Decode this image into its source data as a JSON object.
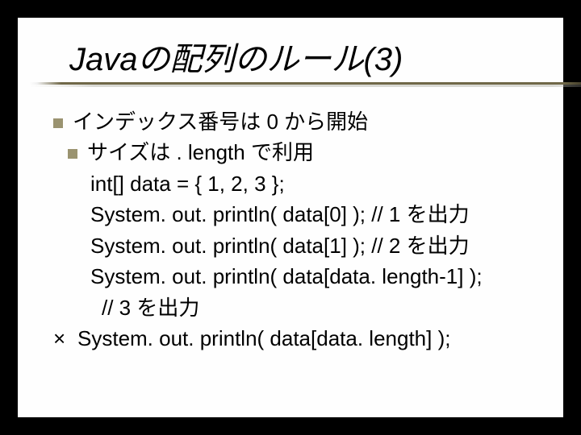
{
  "title": "Javaの配列のルール(3)",
  "bullets": {
    "b1": "インデックス番号は 0 から開始",
    "b2": "サイズは   . length で利用"
  },
  "code": {
    "l1": "int[]  data = { 1, 2, 3 };",
    "l2": "System. out. println( data[0] );  // 1 を出力",
    "l3": "System. out. println( data[1] );  // 2 を出力",
    "l4": "System. out. println( data[data. length-1] );",
    "l5": " // 3 を出力",
    "bad_mark": "×",
    "bad": "System. out. println( data[data. length] );"
  }
}
